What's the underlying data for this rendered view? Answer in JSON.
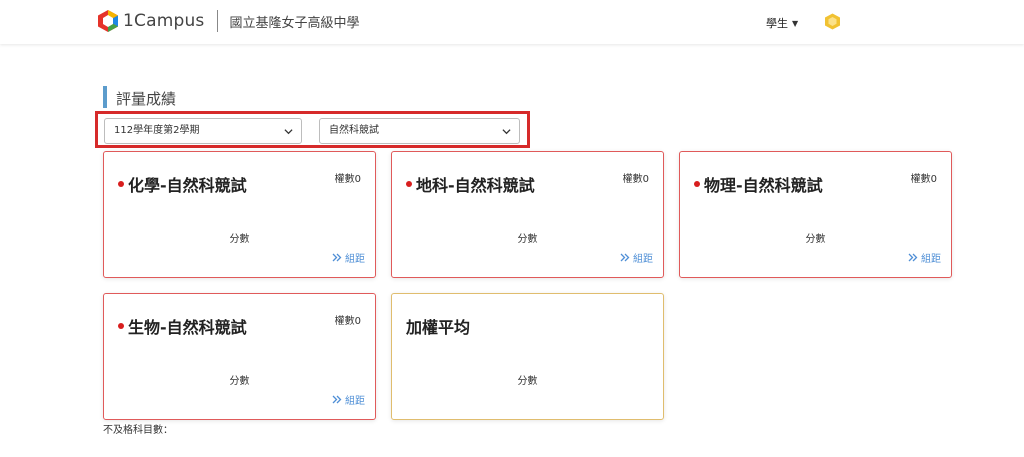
{
  "header": {
    "brand": "1Campus",
    "school": "國立基隆女子高級中學",
    "user_role": "學生",
    "icons": {
      "logo": "1campus-logo-icon",
      "avatar": "hexagon-avatar-icon",
      "caret": "caret-down-icon"
    }
  },
  "section": {
    "title": "評量成績"
  },
  "filters": {
    "term": "112學年度第2學期",
    "exam": "自然科競試",
    "icons": {
      "dropdown": "chevron-down-icon"
    }
  },
  "cards": [
    {
      "title": "化學-自然科競試",
      "weight_label": "權數0",
      "score_label": "分數",
      "link_label": "組距",
      "has_dot": true
    },
    {
      "title": "地科-自然科競試",
      "weight_label": "權數0",
      "score_label": "分數",
      "link_label": "組距",
      "has_dot": true
    },
    {
      "title": "物理-自然科競試",
      "weight_label": "權數0",
      "score_label": "分數",
      "link_label": "組距",
      "has_dot": true
    },
    {
      "title": "生物-自然科競試",
      "weight_label": "權數0",
      "score_label": "分數",
      "link_label": "組距",
      "has_dot": true
    }
  ],
  "average_card": {
    "title": "加權平均",
    "score_label": "分數"
  },
  "footer": {
    "fail_label": "不及格科目數："
  },
  "colors": {
    "accent_bar": "#5c9ccc",
    "highlight_frame": "#d62a2a",
    "card_border": "#e05a5a",
    "avg_border": "#e0bd6e",
    "link": "#4f8fd6",
    "dot": "#d81e1e"
  }
}
